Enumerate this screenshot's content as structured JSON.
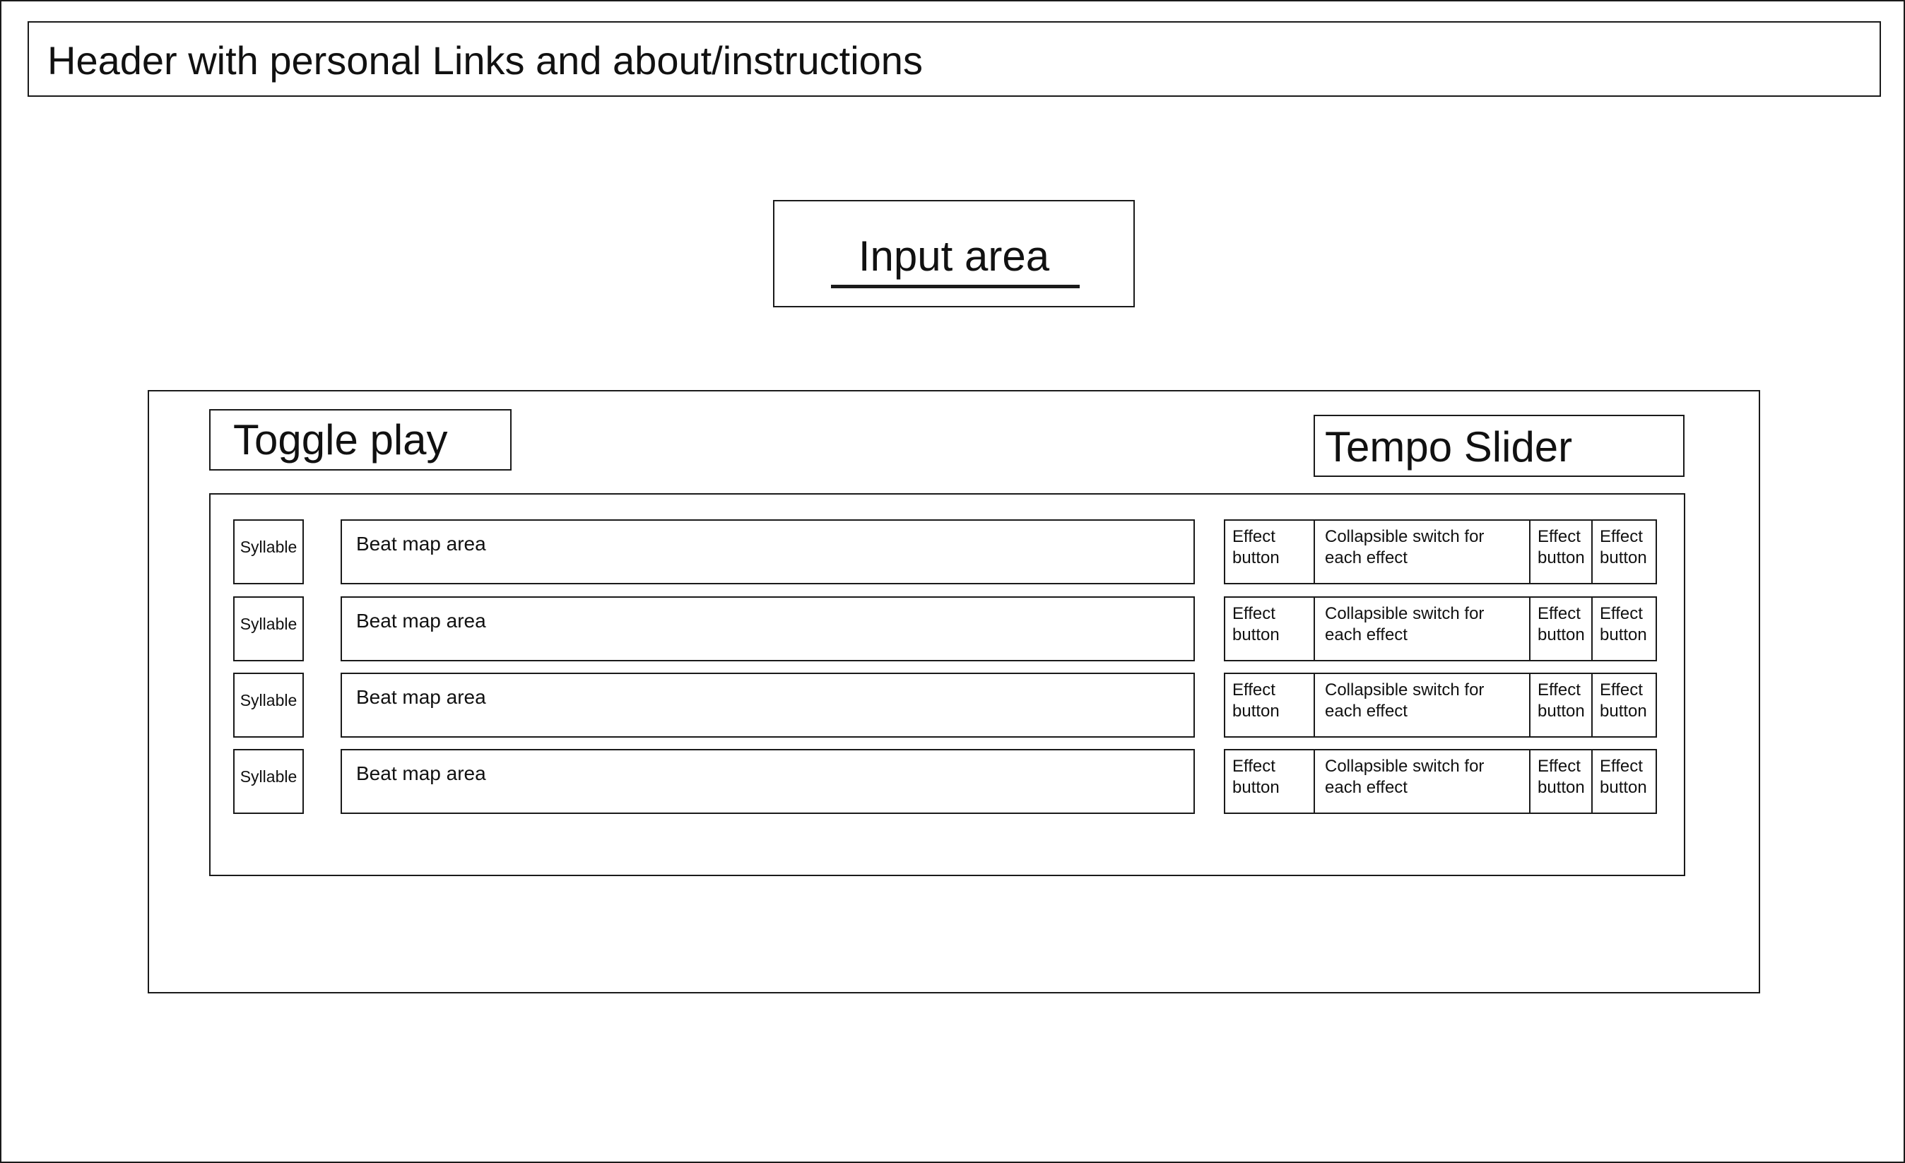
{
  "header": {
    "text": "Header with personal Links and about/instructions"
  },
  "input": {
    "label": "Input area"
  },
  "controls": {
    "toggle_play": "Toggle play",
    "tempo_slider": "Tempo Slider"
  },
  "rows": [
    {
      "syllable": "Syllable",
      "beat_map": "Beat map area",
      "effects": {
        "effect1": [
          "Effect",
          "button"
        ],
        "switch": [
          "Collapsible switch for",
          "each effect"
        ],
        "effect2": [
          "Effect",
          "button"
        ],
        "effect3": [
          "Effect",
          "button"
        ]
      }
    },
    {
      "syllable": "Syllable",
      "beat_map": "Beat map area",
      "effects": {
        "effect1": [
          "Effect",
          "button"
        ],
        "switch": [
          "Collapsible switch for",
          "each effect"
        ],
        "effect2": [
          "Effect",
          "button"
        ],
        "effect3": [
          "Effect",
          "button"
        ]
      }
    },
    {
      "syllable": "Syllable",
      "beat_map": "Beat map area",
      "effects": {
        "effect1": [
          "Effect",
          "button"
        ],
        "switch": [
          "Collapsible switch for",
          "each effect"
        ],
        "effect2": [
          "Effect",
          "button"
        ],
        "effect3": [
          "Effect",
          "button"
        ]
      }
    },
    {
      "syllable": "Syllable",
      "beat_map": "Beat map area",
      "effects": {
        "effect1": [
          "Effect",
          "button"
        ],
        "switch": [
          "Collapsible switch for",
          "each effect"
        ],
        "effect2": [
          "Effect",
          "button"
        ],
        "effect3": [
          "Effect",
          "button"
        ]
      }
    }
  ]
}
